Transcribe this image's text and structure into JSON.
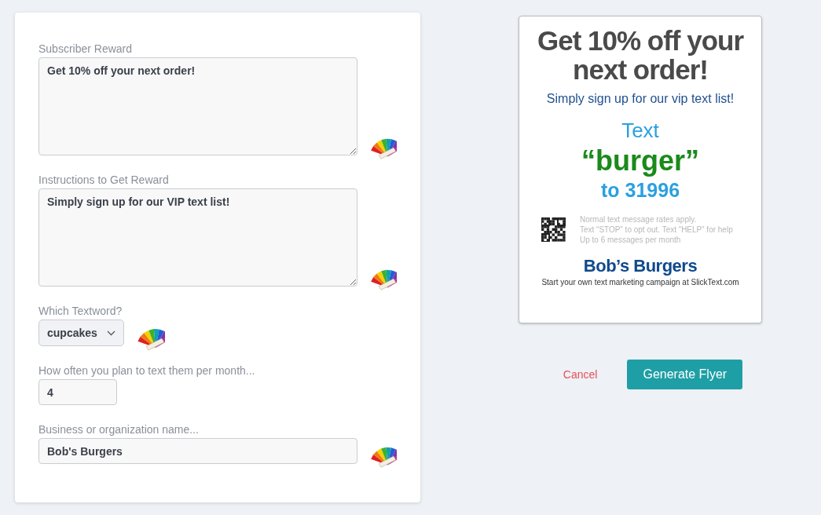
{
  "form": {
    "fields": [
      {
        "kind": "textarea",
        "label": "Subscriber Reward",
        "value": "Get 10% off your next order!",
        "color_picker": true
      },
      {
        "kind": "textarea",
        "label": "Instructions to Get Reward",
        "value": "Simply sign up for our VIP text list!",
        "color_picker": true
      },
      {
        "kind": "select",
        "label": "Which Textword?",
        "value": "cupcakes",
        "color_picker": true
      },
      {
        "kind": "input",
        "label": "How often you plan to text them per month...",
        "value": "4",
        "color_picker": false
      },
      {
        "kind": "wide-input",
        "label": "Business or organization name...",
        "value": "Bob's Burgers",
        "color_picker": true
      }
    ]
  },
  "flyer": {
    "headline": "Get 10% off your next order!",
    "subline": "Simply sign up for our vip text list!",
    "text_label": "Text",
    "keyword": "“burger”",
    "shortcode": "to 31996",
    "disclaimer": [
      "Normal text message rates apply.",
      "Text “STOP” to opt out. Text “HELP” for help",
      "Up to 6 messages per month"
    ],
    "business": "Bob’s Burgers",
    "footer": "Start your own text marketing campaign at SlickText.com"
  },
  "actions": {
    "cancel": "Cancel",
    "generate": "Generate Flyer"
  }
}
